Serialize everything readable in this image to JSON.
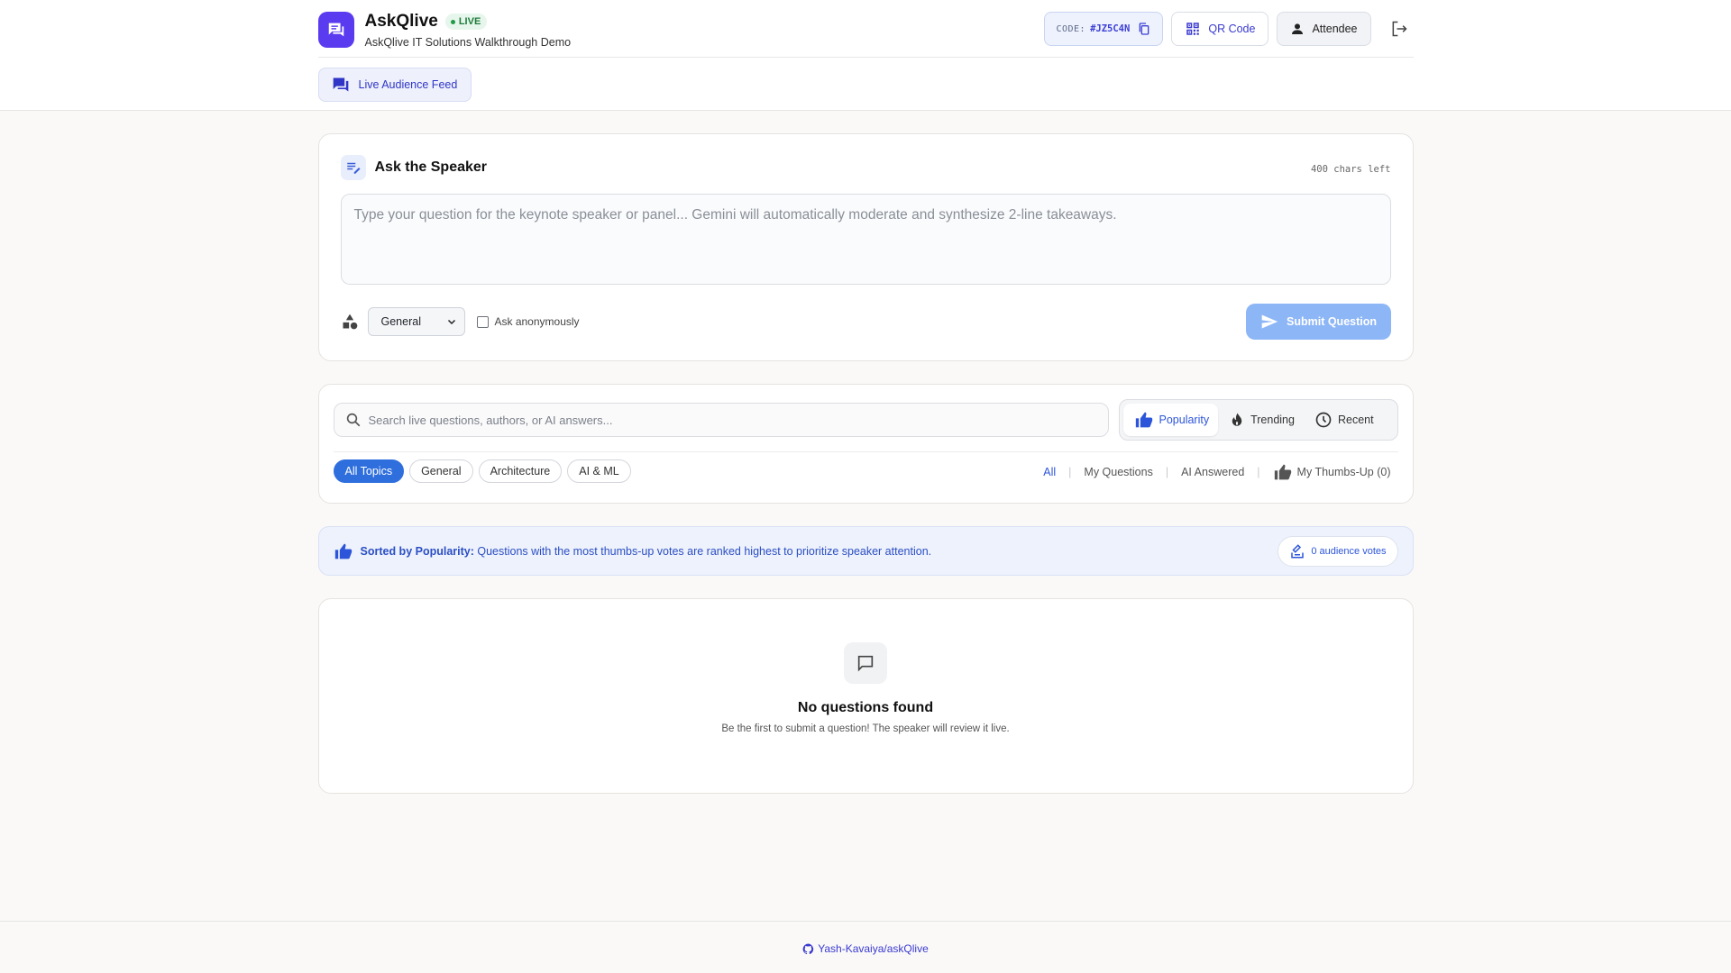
{
  "app": {
    "name": "AskQlive",
    "live_badge": "LIVE",
    "subtitle": "AskQlive IT Solutions Walkthrough Demo"
  },
  "header": {
    "code_label": "CODE:",
    "code_value": "#JZ5C4N",
    "qr_label": "QR Code",
    "role_label": "Attendee",
    "feed_tab_label": "Live Audience Feed"
  },
  "ask": {
    "title": "Ask the Speaker",
    "chars_left": "400 chars left",
    "placeholder": "Type your question for the keynote speaker or panel... Gemini will automatically moderate and synthesize 2-line takeaways.",
    "topic_selected": "General",
    "anonymous_label": "Ask anonymously",
    "submit_label": "Submit Question"
  },
  "filters": {
    "search_placeholder": "Search live questions, authors, or AI answers...",
    "sort": {
      "popularity": "Popularity",
      "trending": "Trending",
      "recent": "Recent"
    },
    "topics": [
      "All Topics",
      "General",
      "Architecture",
      "AI & ML"
    ],
    "views": {
      "all": "All",
      "mine": "My Questions",
      "ai_answered": "AI Answered",
      "thumbs_up": "My Thumbs-Up (0)"
    }
  },
  "banner": {
    "bold": "Sorted by Popularity:",
    "text": " Questions with the most thumbs-up votes are ranked highest to prioritize speaker attention.",
    "votes": "0 audience votes"
  },
  "empty": {
    "title": "No questions found",
    "subtitle": "Be the first to submit a question! The speaker will review it live."
  },
  "footer": {
    "repo": "Yash-Kavaiya/askQlive"
  },
  "colors": {
    "brand": "#5b3bf0",
    "accent": "#2f6fdd",
    "submit_disabled": "#8db6f6",
    "live": "#1e9b45"
  }
}
